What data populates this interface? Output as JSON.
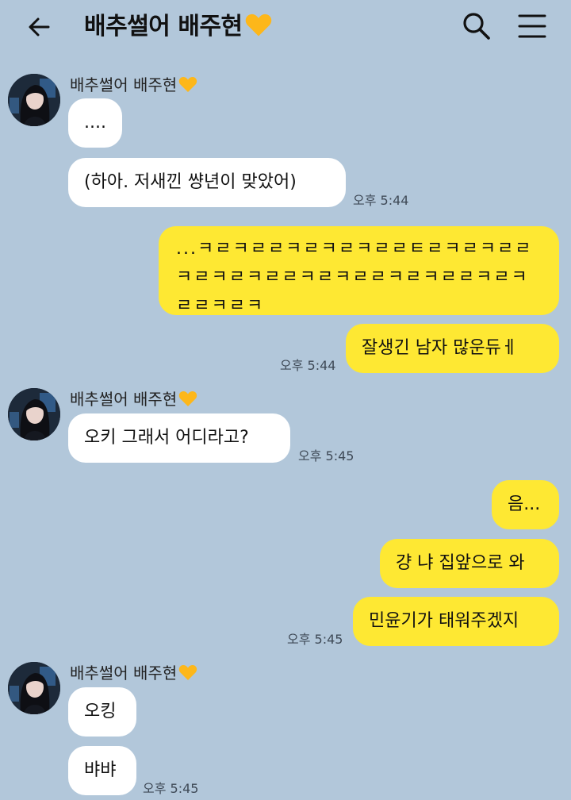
{
  "header": {
    "title": "배추썰어 배주현",
    "back_icon": "arrow-left-icon",
    "search_icon": "search-icon",
    "menu_icon": "hamburger-menu-icon"
  },
  "colors": {
    "background": "#b2c7da",
    "incoming_bubble": "#ffffff",
    "outgoing_bubble": "#fee833",
    "heart": "#fdb71a"
  },
  "contact": {
    "name": "배추썰어 배주현",
    "name_icon": "yellow-heart-icon"
  },
  "messages": [
    {
      "direction": "in",
      "text": "...."
    },
    {
      "direction": "in",
      "text": "(하아. 저새낀 썅년이 맞았어)",
      "time": "오후 5:44"
    },
    {
      "direction": "out",
      "text": "...ㅋㄹㅋㄹㄹㅋㄹㅋㄹㅋㄹㄹㅌㄹㅋㄹㅋㄹㄹㅋㄹㅋㄹㅋㄹㄹㅋㄹㅋㄹㄹㅋㄹㅋㄹㄹㅋㄹㅋㄹㄹㅋㄹㅋ"
    },
    {
      "direction": "out",
      "text": "잘생긴 남자 많운듀ㅔ",
      "time": "오후 5:44"
    },
    {
      "direction": "in",
      "text": "오키 그래서 어디라고?",
      "time": "오후 5:45"
    },
    {
      "direction": "out",
      "text": "음..."
    },
    {
      "direction": "out",
      "text": "걍 냐 집앞으로 와"
    },
    {
      "direction": "out",
      "text": "민윤기가 태워주겠지",
      "time": "오후 5:45"
    },
    {
      "direction": "in",
      "text": "오킹"
    },
    {
      "direction": "in",
      "text": "뱌뱌",
      "time": "오후 5:45"
    }
  ]
}
